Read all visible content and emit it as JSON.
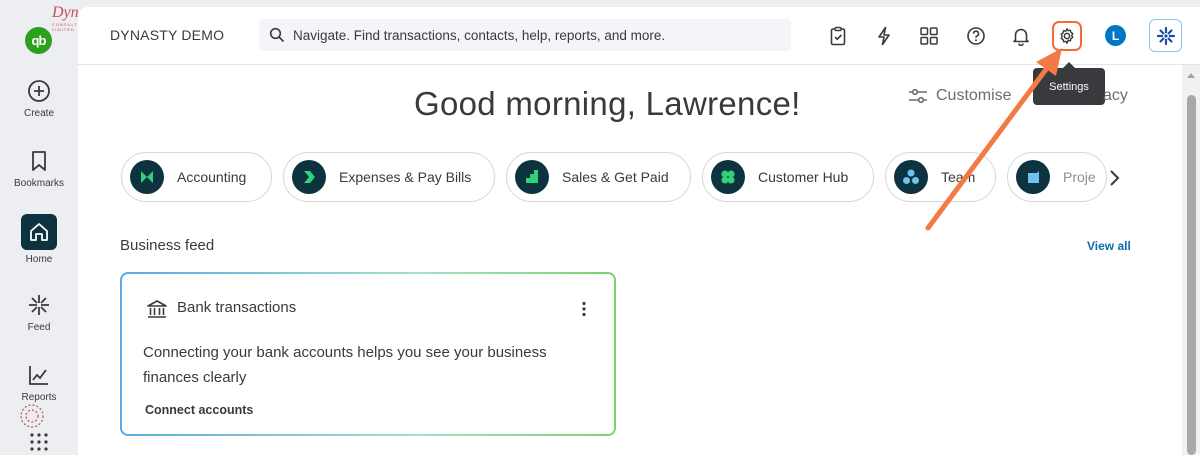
{
  "app": {
    "logo_text": "qb",
    "company_name": "DYNASTY DEMO"
  },
  "rail": {
    "items": [
      {
        "label": "Create",
        "icon": "plus-circle-icon"
      },
      {
        "label": "Bookmarks",
        "icon": "bookmark-icon"
      },
      {
        "label": "Home",
        "icon": "home-icon",
        "active": true
      },
      {
        "label": "Feed",
        "icon": "feed-sparkle-icon"
      },
      {
        "label": "Reports",
        "icon": "line-chart-icon"
      }
    ]
  },
  "watermark": {
    "text": "Dynasty",
    "subtext": "CONSULTING LIMITED"
  },
  "search": {
    "placeholder": "Navigate. Find transactions, contacts, help, reports, and more."
  },
  "topbar_icons": [
    "clipboard-check-icon",
    "lightning-icon",
    "apps-icon",
    "help-icon",
    "bell-icon",
    "gear-icon"
  ],
  "user": {
    "avatar_initial": "L"
  },
  "tooltip": {
    "text": "Settings"
  },
  "greeting": "Good morning, Lawrence!",
  "customise_label": "Customise",
  "privacy_label": "acy",
  "pills": [
    {
      "label": "Accounting",
      "icon": "accounting-icon"
    },
    {
      "label": "Expenses & Pay Bills",
      "icon": "expenses-icon"
    },
    {
      "label": "Sales & Get Paid",
      "icon": "sales-icon"
    },
    {
      "label": "Customer Hub",
      "icon": "customer-hub-icon"
    },
    {
      "label": "Team",
      "icon": "team-icon"
    },
    {
      "label": "Proje",
      "icon": "projects-icon"
    }
  ],
  "feed": {
    "title": "Business feed",
    "view_all": "View all",
    "card": {
      "title": "Bank transactions",
      "body": "Connecting your bank accounts helps you see your business finances clearly",
      "link": "Connect accounts"
    }
  },
  "colors": {
    "brand_green": "#2ca01c",
    "dark_teal": "#0d333f",
    "highlight_orange": "#f26b3a",
    "avatar_blue": "#0077c5"
  }
}
